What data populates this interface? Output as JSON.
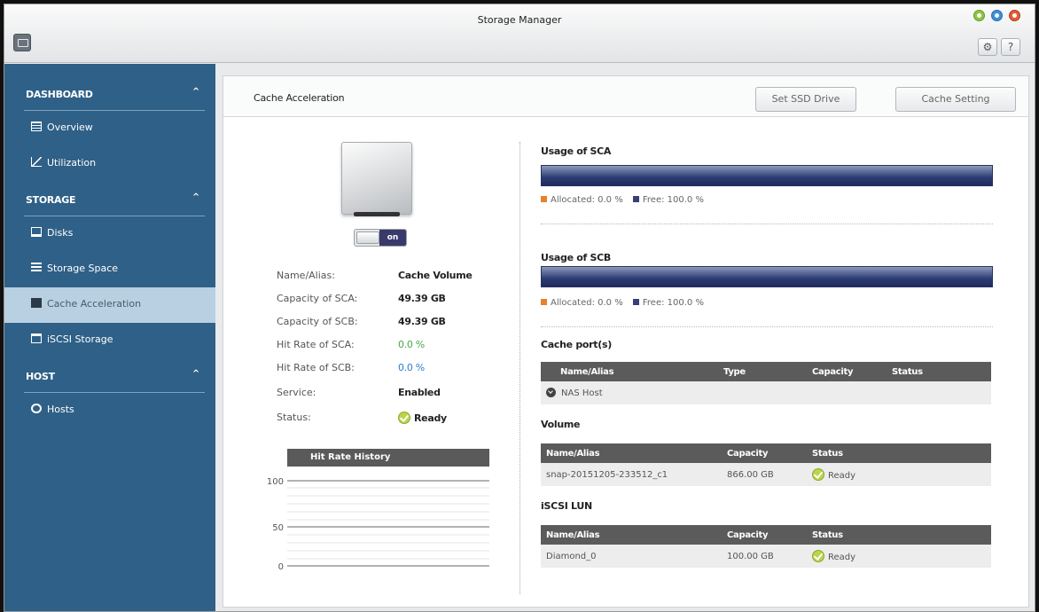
{
  "window": {
    "title": "Storage Manager"
  },
  "toolbar": {
    "settings_icon": "gear-icon",
    "help_label": "?"
  },
  "sidebar": {
    "sections": [
      {
        "label": "DASHBOARD",
        "items": [
          "Overview",
          "Utilization"
        ]
      },
      {
        "label": "STORAGE",
        "items": [
          "Disks",
          "Storage Space",
          "Cache Acceleration",
          "iSCSI Storage"
        ]
      },
      {
        "label": "HOST",
        "items": [
          "Hosts"
        ]
      }
    ],
    "active_item": "Cache Acceleration"
  },
  "main": {
    "title": "Cache Acceleration",
    "buttons": {
      "set_ssd": "Set SSD Drive",
      "cache_setting": "Cache Setting"
    },
    "toggle": {
      "state": "on",
      "label": "on"
    },
    "info": [
      {
        "label": "Name/Alias:",
        "value": "Cache Volume"
      },
      {
        "label": "Capacity of SCA:",
        "value": "49.39 GB"
      },
      {
        "label": "Capacity of SCB:",
        "value": "49.39 GB"
      },
      {
        "label": "Hit Rate of SCA:",
        "value": "0.0 %"
      },
      {
        "label": "Hit Rate of SCB:",
        "value": "0.0 %"
      },
      {
        "label": "Service:",
        "value": "Enabled"
      },
      {
        "label": "Status:",
        "value": "Ready"
      }
    ],
    "hit_rate": {
      "title": "Hit Rate History",
      "y_ticks": [
        "100",
        "50",
        "0"
      ]
    },
    "usage_sca": {
      "heading": "Usage of SCA",
      "allocated": "Allocated: 0.0 %",
      "free": "Free: 100.0 %",
      "allocated_pct": 0.0,
      "free_pct": 100.0
    },
    "usage_scb": {
      "heading": "Usage of SCB",
      "allocated": "Allocated: 0.0 %",
      "free": "Free: 100.0 %",
      "allocated_pct": 0.0,
      "free_pct": 100.0
    },
    "cache_ports": {
      "heading": "Cache port(s)",
      "columns": [
        "Name/Alias",
        "Type",
        "Capacity",
        "Status"
      ],
      "rows": [
        {
          "name": "NAS Host"
        }
      ]
    },
    "volume": {
      "heading": "Volume",
      "columns": [
        "Name/Alias",
        "Capacity",
        "Status"
      ],
      "rows": [
        {
          "name": "snap-20151205-233512_c1",
          "capacity": "866.00 GB",
          "status": "Ready"
        }
      ]
    },
    "iscsi_lun": {
      "heading": "iSCSI LUN",
      "columns": [
        "Name/Alias",
        "Capacity",
        "Status"
      ],
      "rows": [
        {
          "name": "Diamond_0",
          "capacity": "100.00 GB",
          "status": "Ready"
        }
      ]
    }
  },
  "colors": {
    "sidebar_bg": "#2f6087",
    "usage_bar": "#2c3b73",
    "allocated": "#e8812c",
    "free": "#3a3f78",
    "ready": "#b9d54a",
    "hit_rate_sca": "#46a846",
    "hit_rate_scb": "#2b7dd1"
  }
}
